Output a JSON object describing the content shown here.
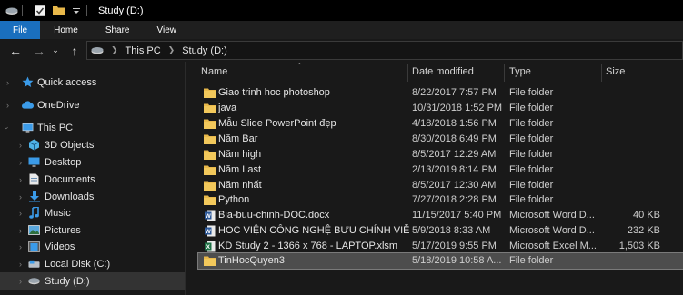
{
  "window": {
    "title": "Study (D:)"
  },
  "ribbon": {
    "tabs": [
      "File",
      "Home",
      "Share",
      "View"
    ]
  },
  "address": {
    "crumbs": [
      "This PC",
      "Study (D:)"
    ]
  },
  "nav": {
    "items": [
      {
        "label": "Quick access",
        "icon": "star-icon"
      },
      {
        "label": "OneDrive",
        "icon": "cloud-icon"
      },
      {
        "label": "This PC",
        "icon": "computer-icon"
      },
      {
        "label": "3D Objects",
        "icon": "cube-icon"
      },
      {
        "label": "Desktop",
        "icon": "desktop-icon"
      },
      {
        "label": "Documents",
        "icon": "document-icon"
      },
      {
        "label": "Downloads",
        "icon": "download-icon"
      },
      {
        "label": "Music",
        "icon": "music-icon"
      },
      {
        "label": "Pictures",
        "icon": "picture-icon"
      },
      {
        "label": "Videos",
        "icon": "video-icon"
      },
      {
        "label": "Local Disk (C:)",
        "icon": "drive-icon"
      },
      {
        "label": "Study (D:)",
        "icon": "drive-icon"
      }
    ]
  },
  "columns": {
    "name": "Name",
    "date": "Date modified",
    "type": "Type",
    "size": "Size"
  },
  "files": [
    {
      "name": "Giao trinh hoc photoshop",
      "date": "8/22/2017 7:57 PM",
      "type": "File folder",
      "size": "",
      "icon": "folder-icon"
    },
    {
      "name": "java",
      "date": "10/31/2018 1:52 PM",
      "type": "File folder",
      "size": "",
      "icon": "folder-icon"
    },
    {
      "name": "Mẫu Slide PowerPoint đẹp",
      "date": "4/18/2018 1:56 PM",
      "type": "File folder",
      "size": "",
      "icon": "folder-icon"
    },
    {
      "name": "Năm Bar",
      "date": "8/30/2018 6:49 PM",
      "type": "File folder",
      "size": "",
      "icon": "folder-icon"
    },
    {
      "name": "Năm high",
      "date": "8/5/2017 12:29 AM",
      "type": "File folder",
      "size": "",
      "icon": "folder-icon"
    },
    {
      "name": "Năm Last",
      "date": "2/13/2019 8:14 PM",
      "type": "File folder",
      "size": "",
      "icon": "folder-icon"
    },
    {
      "name": "Năm nhất",
      "date": "8/5/2017 12:30 AM",
      "type": "File folder",
      "size": "",
      "icon": "folder-icon"
    },
    {
      "name": "Python",
      "date": "7/27/2018 2:28 PM",
      "type": "File folder",
      "size": "",
      "icon": "folder-icon"
    },
    {
      "name": "Bia-buu-chinh-DOC.docx",
      "date": "11/15/2017 5:40 PM",
      "type": "Microsoft Word D...",
      "size": "40 KB",
      "icon": "word-icon"
    },
    {
      "name": "HOC VIỆN CÔNG NGHỆ BƯU CHÍNH VIỄ...",
      "date": "5/9/2018 8:33 AM",
      "type": "Microsoft Word D...",
      "size": "232 KB",
      "icon": "word-icon"
    },
    {
      "name": "KD Study 2 - 1366 x 768 - LAPTOP.xlsm",
      "date": "5/17/2019 9:55 PM",
      "type": "Microsoft Excel M...",
      "size": "1,503 KB",
      "icon": "excel-icon"
    },
    {
      "name": "TinHocQuyen3",
      "date": "5/18/2019 10:58 A...",
      "type": "File folder",
      "size": "",
      "icon": "folder-icon"
    }
  ],
  "colors": {
    "accent": "#1a6fbe",
    "folder": "#e8b84a",
    "background": "#191919"
  }
}
